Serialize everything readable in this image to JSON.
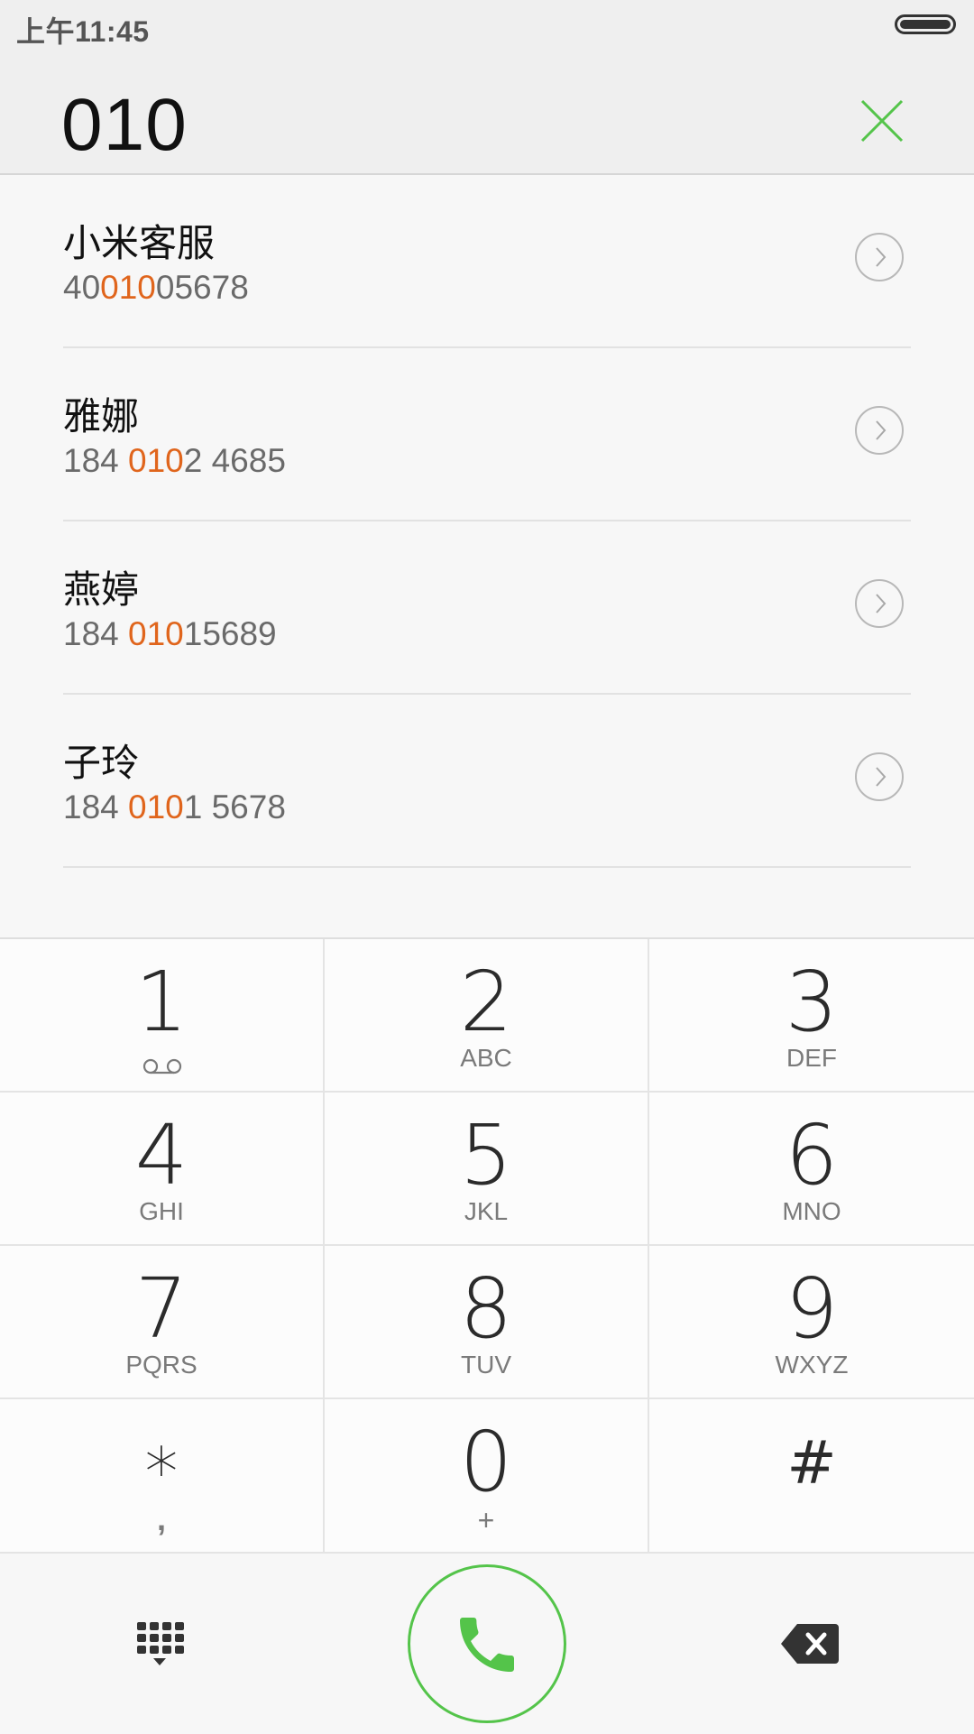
{
  "status_bar": {
    "time": "上午11:45"
  },
  "search": {
    "dialed_number": "010"
  },
  "results": [
    {
      "name": "小米客服",
      "number_pre": "40",
      "number_match": "010",
      "number_post": "05678"
    },
    {
      "name": "雅娜",
      "number_pre": "184 ",
      "number_match": "010",
      "number_post": "2 4685"
    },
    {
      "name": "燕婷",
      "number_pre": "184 ",
      "number_match": "010",
      "number_post": "15689"
    },
    {
      "name": "子玲",
      "number_pre": "184 ",
      "number_match": "010",
      "number_post": "1 5678"
    }
  ],
  "keypad": {
    "keys": [
      {
        "digit": "1",
        "letters": ""
      },
      {
        "digit": "2",
        "letters": "ABC"
      },
      {
        "digit": "3",
        "letters": "DEF"
      },
      {
        "digit": "4",
        "letters": "GHI"
      },
      {
        "digit": "5",
        "letters": "JKL"
      },
      {
        "digit": "6",
        "letters": "MNO"
      },
      {
        "digit": "7",
        "letters": "PQRS"
      },
      {
        "digit": "8",
        "letters": "TUV"
      },
      {
        "digit": "9",
        "letters": "WXYZ"
      },
      {
        "digit": "*",
        "letters": ","
      },
      {
        "digit": "0",
        "letters": "+"
      },
      {
        "digit": "#",
        "letters": ""
      }
    ]
  },
  "icons": {
    "clear": "close-icon",
    "detail": "chevron-right-icon",
    "voicemail": "voicemail-icon",
    "dialpad": "dialpad-icon",
    "call": "phone-icon",
    "backspace": "backspace-icon"
  },
  "colors": {
    "accent_green": "#54c44a",
    "highlight_orange": "#e0651c"
  }
}
